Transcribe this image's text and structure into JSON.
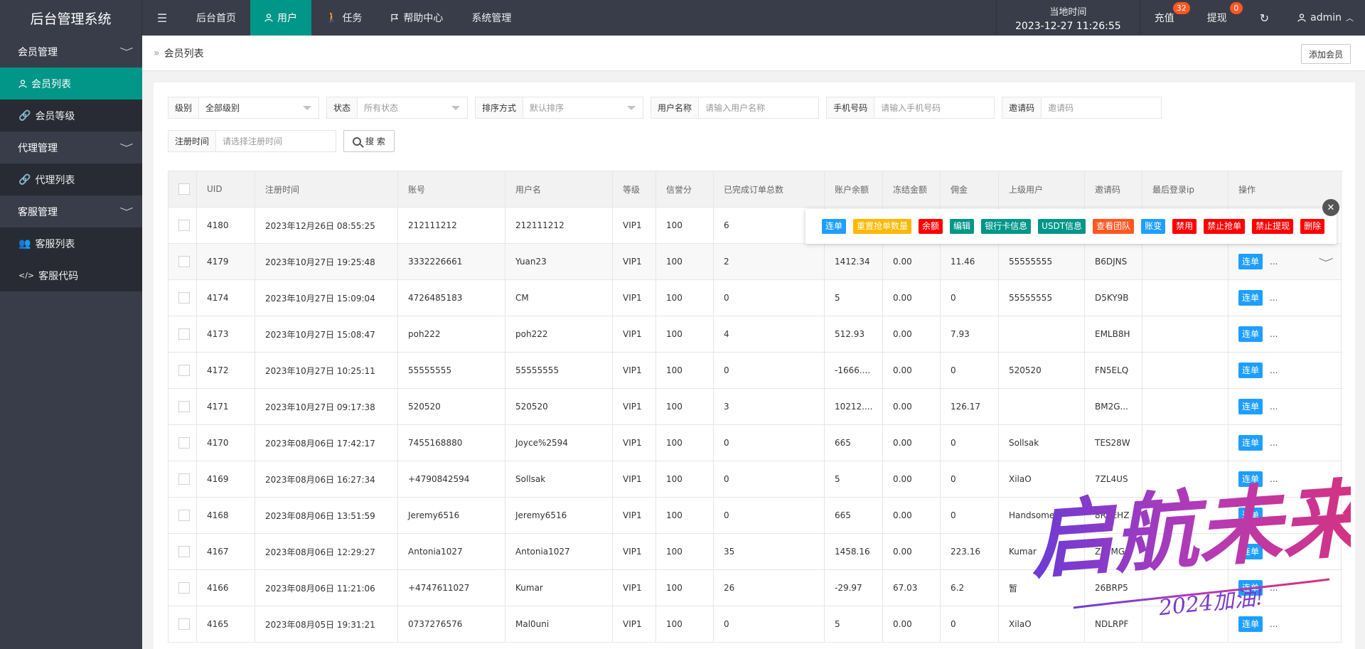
{
  "app": {
    "title": "后台管理系统"
  },
  "nav": [
    {
      "label": "后台首页",
      "icon": ""
    },
    {
      "label": "用户",
      "icon": "user-icon",
      "active": true
    },
    {
      "label": "任务",
      "icon": "walk-icon"
    },
    {
      "label": "帮助中心",
      "icon": "flag-icon"
    },
    {
      "label": "系统管理",
      "icon": ""
    }
  ],
  "header": {
    "time_label": "当地时间",
    "time_value": "2023-12-27 11:26:55",
    "recharge_label": "充值",
    "recharge_count": "32",
    "withdraw_label": "提现",
    "withdraw_count": "0",
    "user_name": "admin"
  },
  "sidebar": {
    "groups": [
      {
        "label": "会员管理",
        "items": [
          {
            "label": "会员列表",
            "active": true
          },
          {
            "label": "会员等级"
          }
        ]
      },
      {
        "label": "代理管理",
        "items": [
          {
            "label": "代理列表"
          }
        ]
      },
      {
        "label": "客服管理",
        "items": [
          {
            "label": "客服列表"
          },
          {
            "label": "客服代码"
          }
        ]
      }
    ]
  },
  "breadcrumb": {
    "current": "会员列表",
    "add_button": "添加会员"
  },
  "filters": {
    "level_label": "级别",
    "level_value": "全部级别",
    "status_label": "状态",
    "status_placeholder": "所有状态",
    "sort_label": "排序方式",
    "sort_placeholder": "默认排序",
    "username_label": "用户名称",
    "username_placeholder": "请输入用户名称",
    "phone_label": "手机号码",
    "phone_placeholder": "请输入手机号码",
    "invite_label": "邀请码",
    "invite_placeholder": "邀请码",
    "regtime_label": "注册时间",
    "regtime_placeholder": "请选择注册时间",
    "search_button": "搜 索"
  },
  "table": {
    "columns": [
      "UID",
      "注册时间",
      "账号",
      "用户名",
      "等级",
      "信誉分",
      "已完成订单总数",
      "账户余额",
      "冻结金额",
      "佣金",
      "上级用户",
      "邀请码",
      "最后登录ip",
      "操作"
    ],
    "op_label": "连单",
    "more_label": "...",
    "rows": [
      [
        "4180",
        "2023年12月26日 08:55:25",
        "212111212",
        "212111212",
        "VIP1",
        "100",
        "6",
        "",
        "",
        "",
        "",
        "",
        "",
        ""
      ],
      [
        "4179",
        "2023年10月27日 19:25:48",
        "3332226661",
        "Yuan23",
        "VIP1",
        "100",
        "2",
        "1412.34",
        "0.00",
        "11.46",
        "55555555",
        "B6DJNS",
        "",
        ""
      ],
      [
        "4174",
        "2023年10月27日 15:09:04",
        "4726485183",
        "CM",
        "VIP1",
        "100",
        "0",
        "5",
        "0.00",
        "0",
        "55555555",
        "D5KY9B",
        "",
        ""
      ],
      [
        "4173",
        "2023年10月27日 15:08:47",
        "poh222",
        "poh222",
        "VIP1",
        "100",
        "4",
        "512.93",
        "0.00",
        "7.93",
        "",
        "EMLB8H",
        "",
        ""
      ],
      [
        "4172",
        "2023年10月27日 10:25:11",
        "55555555",
        "55555555",
        "VIP1",
        "100",
        "0",
        "-1666....",
        "0.00",
        "0",
        "520520",
        "FN5ELQ",
        "",
        ""
      ],
      [
        "4171",
        "2023年10月27日 09:17:38",
        "520520",
        "520520",
        "VIP1",
        "100",
        "3",
        "10212....",
        "0.00",
        "126.17",
        "",
        "BM2G...",
        "",
        ""
      ],
      [
        "4170",
        "2023年08月06日 17:42:17",
        "7455168880",
        "Joyce%2594",
        "VIP1",
        "100",
        "0",
        "665",
        "0.00",
        "0",
        "Sollsak",
        "TES28W",
        "",
        ""
      ],
      [
        "4169",
        "2023年08月06日 16:27:34",
        "+4790842594",
        "Sollsak",
        "VIP1",
        "100",
        "0",
        "5",
        "0.00",
        "0",
        "XilaO",
        "7ZL4US",
        "",
        ""
      ],
      [
        "4168",
        "2023年08月06日 13:51:59",
        "Jeremy6516",
        "Jeremy6516",
        "VIP1",
        "100",
        "0",
        "665",
        "0.00",
        "0",
        "Handsome7",
        "8RSEHZ",
        "",
        ""
      ],
      [
        "4167",
        "2023年08月06日 12:29:27",
        "Antonia1027",
        "Antonia1027",
        "VIP1",
        "100",
        "35",
        "1458.16",
        "0.00",
        "223.16",
        "Kumar",
        "ZL7MG",
        "",
        ""
      ],
      [
        "4166",
        "2023年08月06日 11:21:06",
        "+4747611027",
        "Kumar",
        "VIP1",
        "100",
        "26",
        "-29.97",
        "67.03",
        "6.2",
        "暂",
        "26BRP5",
        "",
        ""
      ],
      [
        "4165",
        "2023年08月05日 19:31:21",
        "0737276576",
        "Mal0uni",
        "VIP1",
        "100",
        "0",
        "5",
        "0.00",
        "0",
        "XilaO",
        "NDLRPF",
        "",
        ""
      ]
    ]
  },
  "action_toolbar": {
    "buttons": [
      {
        "label": "连单",
        "color": "blue"
      },
      {
        "label": "重置抢单数量",
        "color": "orange"
      },
      {
        "label": "余额",
        "color": "red"
      },
      {
        "label": "编辑",
        "color": "green"
      },
      {
        "label": "银行卡信息",
        "color": "green"
      },
      {
        "label": "USDT信息",
        "color": "green"
      },
      {
        "label": "查看团队",
        "color": "coral"
      },
      {
        "label": "账变",
        "color": "blue"
      },
      {
        "label": "禁用",
        "color": "red"
      },
      {
        "label": "禁止抢单",
        "color": "red"
      },
      {
        "label": "禁止提现",
        "color": "red"
      },
      {
        "label": "删除",
        "color": "red"
      }
    ]
  },
  "watermark": {
    "main": "启航未来",
    "sub": "2024加油!"
  },
  "colors": {
    "primary": "#009688",
    "blue": "#1e9fff",
    "dark": "#393d49",
    "badge": "#ff5722"
  }
}
